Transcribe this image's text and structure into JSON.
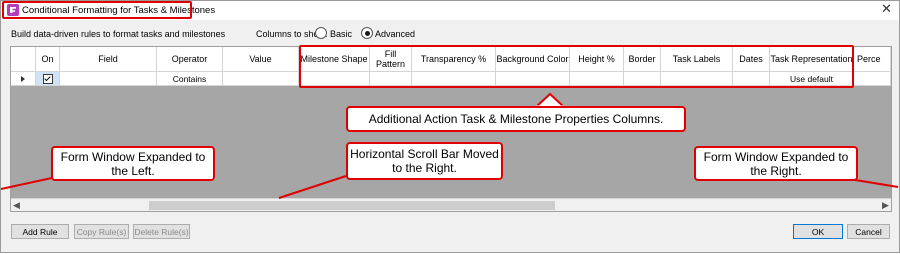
{
  "window": {
    "title": "Conditional Formatting for Tasks & Milestones",
    "close_glyph": "✕"
  },
  "header": {
    "subtitle": "Build data-driven rules to format tasks and milestones",
    "columns_label": "Columns to show:",
    "radio_basic": "Basic",
    "radio_advanced": "Advanced",
    "selected": "Advanced"
  },
  "grid": {
    "columns": [
      "On",
      "Field",
      "Operator",
      "Value",
      "Milestone Shape",
      "Fill Pattern",
      "Transparency %",
      "Background Color",
      "Height %",
      "Border",
      "Task Labels",
      "Dates",
      "Task Representation",
      "Perce"
    ],
    "row": {
      "on_checked": true,
      "field": "",
      "operator": "Contains",
      "value": "",
      "task_representation": "Use default"
    }
  },
  "callouts": {
    "columns": "Additional Action Task & Milestone Properties Columns.",
    "left": "Form Window Expanded to the Left.",
    "scroll": "Horizontal Scroll Bar Moved to the Right.",
    "right": "Form Window Expanded to the Right."
  },
  "buttons": {
    "add_rule": "Add Rule",
    "copy_rule": "Copy Rule(s)",
    "delete_rule": "Delete Rule(s)",
    "ok": "OK",
    "cancel": "Cancel"
  },
  "colors": {
    "highlight": "#e00000",
    "grid_bg": "#a6a6a6",
    "app_icon": "#b13dbd"
  },
  "icons": [
    "app-icon",
    "close-icon",
    "row-pointer-icon",
    "checkbox-checked-icon",
    "scroll-left-icon",
    "scroll-right-icon"
  ]
}
